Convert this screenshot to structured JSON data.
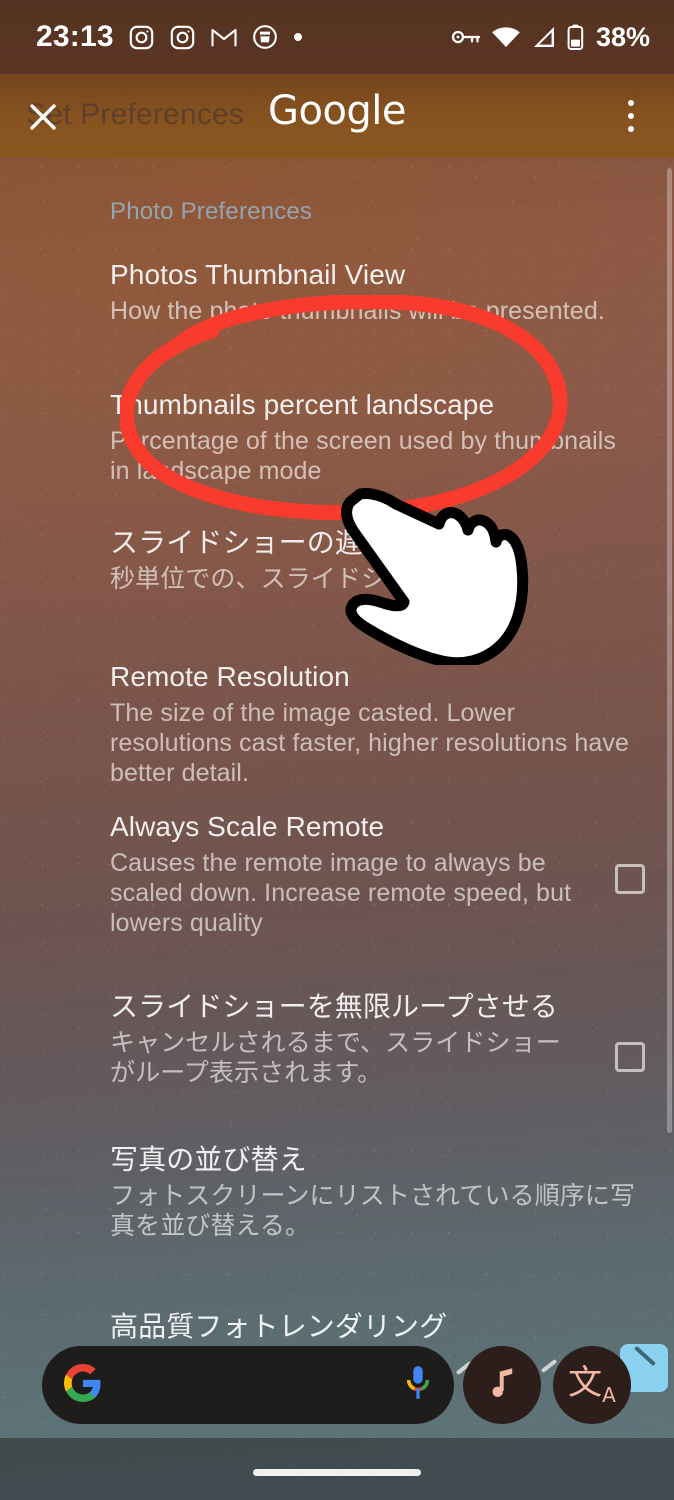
{
  "status_bar": {
    "time": "23:13",
    "left_icons": [
      "instagram-icon",
      "instagram-icon",
      "gmail-icon",
      "drink-tracker-icon",
      "notification-dot-icon"
    ],
    "right_icons": [
      "vpn-key-icon",
      "wifi-icon",
      "cellular-signal-icon",
      "battery-icon"
    ],
    "battery_percent": "38%"
  },
  "app_bar": {
    "title": "Set Preferences",
    "close_icon": "close-icon",
    "overlay_brand": "Google",
    "menu_icon": "more-vertical-icon"
  },
  "settings": {
    "category": "Photo Preferences",
    "items": [
      {
        "title": "Photos Thumbnail View",
        "summary": "How the photo thumbnails will be presented.",
        "has_checkbox": false,
        "checked": false
      },
      {
        "title": "Thumbnails percent landscape",
        "summary": "Percentage of the screen used by thumbnails in landscape mode",
        "has_checkbox": false,
        "checked": false,
        "highlighted": true
      },
      {
        "title": "スライドショーの遅延",
        "summary": "秒単位での、スライドショー",
        "has_checkbox": false,
        "checked": false
      },
      {
        "title": "Remote Resolution",
        "summary": "The size of the image casted. Lower resolutions cast faster, higher resolutions have better detail.",
        "has_checkbox": false,
        "checked": false
      },
      {
        "title": "Always Scale Remote",
        "summary": "Causes the remote image to always be scaled down. Increase remote speed, but lowers quality",
        "has_checkbox": true,
        "checked": false
      },
      {
        "title": "スライドショーを無限ループさせる",
        "summary": "キャンセルされるまで、スライドショーがループ表示されます。",
        "has_checkbox": true,
        "checked": false
      },
      {
        "title": "写真の並び替え",
        "summary": "フォトスクリーンにリストされている順序に写真を並び替える。",
        "has_checkbox": false,
        "checked": false
      },
      {
        "title": "高品質フォトレンダリング",
        "summary": "",
        "has_checkbox": false,
        "checked": false
      }
    ]
  },
  "annotation": {
    "shape": "ellipse",
    "color": "#f93b2e",
    "target": "Thumbnails percent landscape",
    "cursor_icon": "pointing-hand-cursor"
  },
  "dock": {
    "search_placeholder": "",
    "google_logo_icon": "google-g-icon",
    "mic_icon": "microphone-icon",
    "shortcuts": [
      {
        "name": "music-search-button",
        "icon": "music-note-icon"
      },
      {
        "name": "translate-button",
        "icon": "translate-icon",
        "glyph": "文",
        "glyph_sub": "A"
      }
    ],
    "keep_tile_icon": "keep-note-icon"
  },
  "nav_bar": {
    "home_pill_icon": "home-gesture-pill"
  },
  "colors": {
    "app_bar": "#86521f",
    "status_bar": "#5b3524",
    "annotation_red": "#f93b2e",
    "dock_search_bg": "#1f1d1c",
    "category_text": "#96aab9"
  }
}
